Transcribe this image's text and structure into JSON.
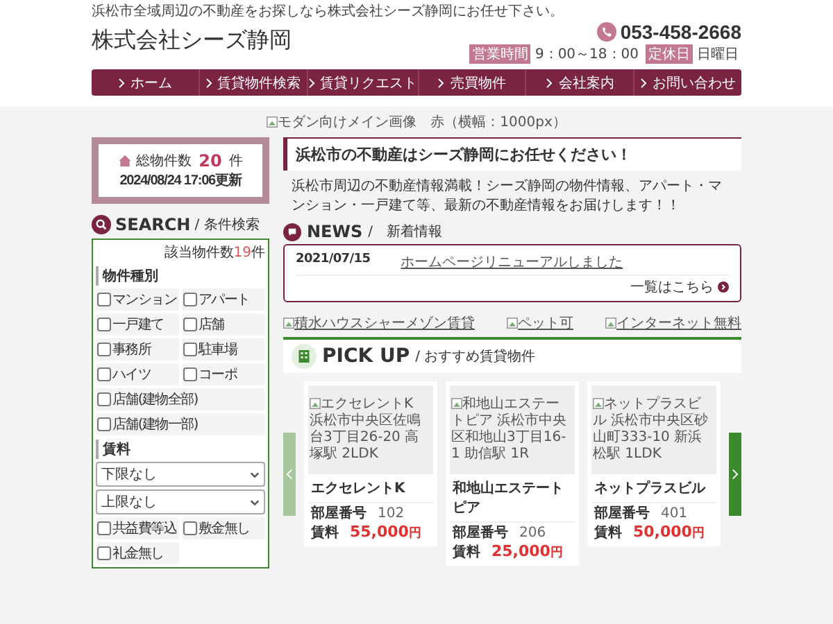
{
  "header": {
    "tagline": "浜松市全域周辺の不動産をお探しなら株式会社シーズ静岡にお任せ下さい。",
    "company": "株式会社シーズ静岡",
    "phone": "053-458-2668",
    "hours": [
      {
        "badge": "営業時間",
        "text": "9：00～18：00"
      },
      {
        "badge": "定休日",
        "text": "日曜日"
      }
    ]
  },
  "nav": [
    "ホーム",
    "賃貸物件検索",
    "賃貸リクエスト",
    "売買物件",
    "会社案内",
    "お問い合わせ"
  ],
  "hero_alt": "モダン向けメイン画像　赤（横幅：1000px）",
  "stats": {
    "label": "総物件数",
    "count": "20",
    "unit": "件",
    "updated": "2024/08/24 17:06更新"
  },
  "search": {
    "title": "SEARCH",
    "subtitle": "/ 条件検索",
    "result_label": "該当物件数",
    "result_count": "19",
    "result_unit": "件",
    "sections": [
      {
        "title": "物件種別",
        "options": [
          {
            "label": "マンション",
            "checked": false,
            "wide": false
          },
          {
            "label": "アパート",
            "checked": false,
            "wide": false
          },
          {
            "label": "一戸建て",
            "checked": false,
            "wide": false
          },
          {
            "label": "店舗",
            "checked": false,
            "wide": false
          },
          {
            "label": "事務所",
            "checked": false,
            "wide": false
          },
          {
            "label": "駐車場",
            "checked": false,
            "wide": false
          },
          {
            "label": "ハイツ",
            "checked": false,
            "wide": false
          },
          {
            "label": "コーポ",
            "checked": false,
            "wide": false
          },
          {
            "label": "店舗(建物全部)",
            "checked": false,
            "wide": true
          },
          {
            "label": "店舗(建物一部)",
            "checked": false,
            "wide": true
          }
        ]
      },
      {
        "title": "賃料",
        "selects": [
          "下限なし",
          "上限なし"
        ],
        "options": [
          {
            "label": "共益費等込",
            "checked": false,
            "wide": false
          },
          {
            "label": "敷金無し",
            "checked": false,
            "wide": false
          },
          {
            "label": "礼金無し",
            "checked": false,
            "wide": false
          }
        ]
      }
    ]
  },
  "intro": {
    "heading": "浜松市の不動産はシーズ静岡にお任せください！",
    "text": "浜松市周辺の不動産情報満載！シーズ静岡の物件情報、アパート・マンション・一戸建て等、最新の不動産情報をお届けします！！"
  },
  "news": {
    "title": "NEWS",
    "subtitle": "/　新着情報",
    "items": [
      {
        "date": "2021/07/15",
        "title": "ホームページリニューアルしました"
      }
    ],
    "more": "一覧はこちら"
  },
  "banners": [
    "積水ハウスシャーメゾン賃貸",
    "ペット可",
    "インターネット無料"
  ],
  "pickup": {
    "title": "PICK UP",
    "subtitle": "/ おすすめ賃貸物件",
    "cards": [
      {
        "image_alt": "エクセレントK 浜松市中央区佐鳴台3丁目26-20 高塚駅 2LDK",
        "name": "エクセレントK",
        "room_label": "部屋番号",
        "room": "102",
        "rent_label": "賃料",
        "rent": "55,000",
        "unit": "円"
      },
      {
        "image_alt": "和地山エステートピア 浜松市中央区和地山3丁目16-1 助信駅 1R",
        "name": "和地山エステートピア",
        "room_label": "部屋番号",
        "room": "206",
        "rent_label": "賃料",
        "rent": "25,000",
        "unit": "円"
      },
      {
        "image_alt": "ネットプラスビル 浜松市中央区砂山町333-10 新浜松駅 1LDK",
        "name": "ネットプラスビル",
        "room_label": "部屋番号",
        "room": "401",
        "rent_label": "賃料",
        "rent": "50,000",
        "unit": "円"
      }
    ]
  }
}
